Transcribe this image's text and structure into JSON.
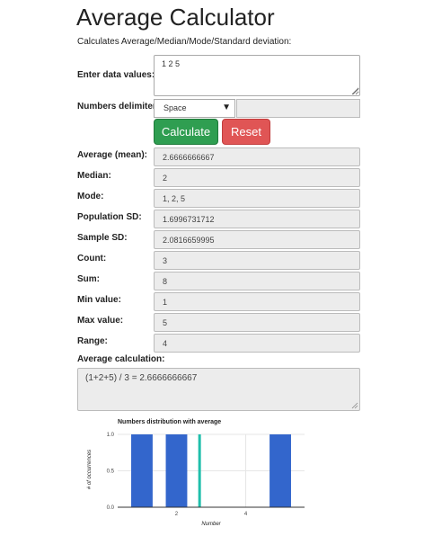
{
  "page": {
    "title": "Average Calculator",
    "subtitle": "Calculates Average/Median/Mode/Standard deviation:"
  },
  "input": {
    "label": "Enter data values:",
    "value": "1 2 5"
  },
  "delimiter": {
    "label": "Numbers delimiter:",
    "selected": "Space",
    "custom_value": ""
  },
  "buttons": {
    "calculate": "Calculate",
    "reset": "Reset"
  },
  "results": [
    {
      "key": "average",
      "label": "Average (mean):",
      "value": "2.6666666667"
    },
    {
      "key": "median",
      "label": "Median:",
      "value": "2"
    },
    {
      "key": "mode",
      "label": "Mode:",
      "value": "1, 2, 5"
    },
    {
      "key": "population-sd",
      "label": "Population SD:",
      "value": "1.6996731712"
    },
    {
      "key": "sample-sd",
      "label": "Sample SD:",
      "value": "2.0816659995"
    },
    {
      "key": "count",
      "label": "Count:",
      "value": "3"
    },
    {
      "key": "sum",
      "label": "Sum:",
      "value": "8"
    },
    {
      "key": "min",
      "label": "Min value:",
      "value": "1"
    },
    {
      "key": "max",
      "label": "Max value:",
      "value": "5"
    },
    {
      "key": "range",
      "label": "Range:",
      "value": "4"
    }
  ],
  "average_calculation": {
    "label": "Average calculation:",
    "value": "(1+2+5) / 3 = 2.6666666667"
  },
  "chart_data": {
    "type": "bar",
    "title": "Numbers distribution with average",
    "xlabel": "Number",
    "ylabel": "# of occurrences",
    "x": [
      1,
      2,
      5
    ],
    "values": [
      1,
      1,
      1
    ],
    "xlim": [
      0.3,
      5.7
    ],
    "ylim": [
      0,
      1
    ],
    "x_ticks": [
      2,
      4
    ],
    "y_ticks": [
      "0.0",
      "0.5",
      "1.0"
    ],
    "average_line": 2.6666666667,
    "grid": true,
    "colors": {
      "bar": "#3366cc",
      "average": "#1fbfab",
      "grid": "#e6e6e6"
    }
  }
}
